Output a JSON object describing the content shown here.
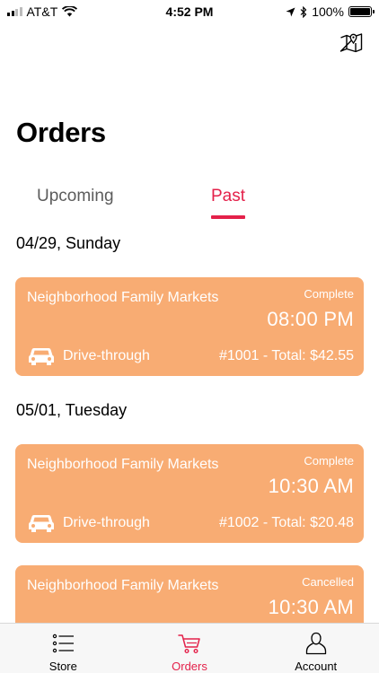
{
  "status_bar": {
    "carrier": "AT&T",
    "time": "4:52 PM",
    "battery": "100%"
  },
  "header": {
    "title": "Orders",
    "map_icon": "map-icon"
  },
  "tabs": [
    {
      "label": "Upcoming",
      "active": false
    },
    {
      "label": "Past",
      "active": true
    }
  ],
  "groups": [
    {
      "date": "04/29, Sunday",
      "orders": [
        {
          "store": "Neighborhood Family Markets",
          "status": "Complete",
          "time": "08:00 PM",
          "method": "Drive-through",
          "total": "#1001 - Total: $42.55"
        }
      ]
    },
    {
      "date": "05/01, Tuesday",
      "orders": [
        {
          "store": "Neighborhood Family Markets",
          "status": "Complete",
          "time": "10:30 AM",
          "method": "Drive-through",
          "total": "#1002 - Total: $20.48"
        },
        {
          "store": "Neighborhood Family Markets",
          "status": "Cancelled",
          "time": "10:30 AM",
          "method": "",
          "total": ""
        }
      ]
    }
  ],
  "tab_bar": [
    {
      "label": "Store",
      "icon": "list-icon",
      "active": false
    },
    {
      "label": "Orders",
      "icon": "cart-icon",
      "active": true
    },
    {
      "label": "Account",
      "icon": "person-icon",
      "active": false
    }
  ],
  "colors": {
    "accent": "#e4214a",
    "card": "#f8ac73"
  }
}
